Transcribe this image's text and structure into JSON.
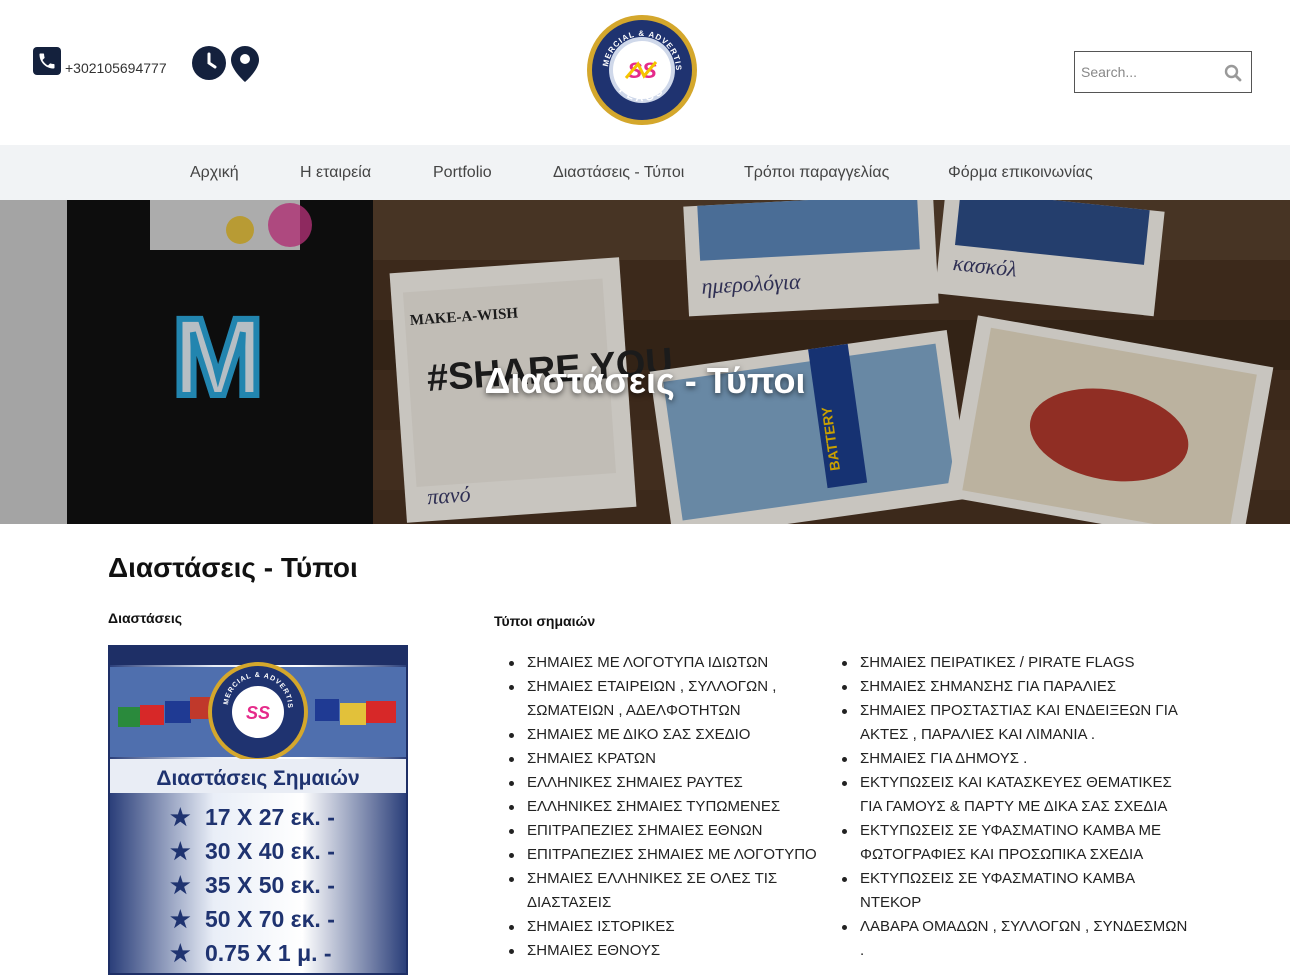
{
  "header": {
    "phone": "+302105694777",
    "logo_text_top": "COMMERCIAL & ADVERTISING",
    "logo_text_bottom": "FLAGS",
    "logo_mark": "SS",
    "search_placeholder": "Search..."
  },
  "nav": {
    "items": [
      {
        "label": "Αρχική"
      },
      {
        "label": "Η εταιρεία"
      },
      {
        "label": "Portfolio"
      },
      {
        "label": "Διαστάσεις - Τύποι"
      },
      {
        "label": "Τρόποι παραγγελίας"
      },
      {
        "label": "Φόρμα επικοινωνίας"
      }
    ]
  },
  "hero": {
    "title": "Διαστάσεις - Τύποι",
    "photo_labels": [
      "ημερολόγια",
      "κασκόλ",
      "πανό",
      "MAKE-A-WISH",
      "#SHARE YOU",
      "BATTERY"
    ]
  },
  "main": {
    "title": "Διαστάσεις - Τύποι",
    "dimensions_heading": "Διαστάσεις",
    "types_heading": "Τύποι σημαιών",
    "poster": {
      "title": "Διαστάσεις Σημαιών",
      "sizes": [
        "17 Χ 27 εκ. -",
        "30 Χ 40 εκ. -",
        "35 Χ 50 εκ. -",
        "50 Χ 70 εκ. -",
        "0.75 Χ 1 μ. -"
      ]
    },
    "types_left": [
      "ΣΗΜΑΙΕΣ  ΜΕ ΛΟΓΟΤΥΠΑ ΙΔΙΩΤΩΝ",
      "ΣΗΜΑΙΕΣ ΕΤΑΙΡΕΙΩΝ , ΣΥΛΛΟΓΩΝ , ΣΩΜΑΤΕΙΩΝ , ΑΔΕΛΦΟΤΗΤΩΝ",
      "ΣΗΜΑΙΕΣ ΜΕ ΔΙΚΟ ΣΑΣ ΣΧΕΔΙΟ",
      "ΣΗΜΑΙΕΣ ΚΡΑΤΩΝ",
      "ΕΛΛΗΝΙΚΕΣ ΣΗΜΑΙΕΣ ΡΑΥΤΕΣ",
      "ΕΛΛΗΝΙΚΕΣ ΣΗΜΑΙΕΣ ΤΥΠΩΜΕΝΕΣ",
      "ΕΠΙΤΡΑΠΕΖΙΕΣ ΣΗΜΑΙΕΣ  ΕΘΝΩΝ",
      "ΕΠΙΤΡΑΠΕΖΙΕΣ ΣΗΜΑΙΕΣ  ΜΕ ΛΟΓΟΤΥΠΟ",
      "ΣΗΜΑΙΕΣ ΕΛΛΗΝΙΚΕΣ  ΣΕ ΟΛΕΣ ΤΙΣ ΔΙΑΣΤΑΣΕΙΣ",
      "ΣΗΜΑΙΕΣ ΙΣΤΟΡΙΚΕΣ",
      "ΣΗΜΑΙΕΣ ΕΘΝΟΥΣ"
    ],
    "types_right": [
      "ΣΗΜΑΙΕΣ ΠΕΙΡΑΤΙΚΕΣ / PIRATE FLAGS",
      "ΣΗΜΑΙΕΣ ΣΗΜΑΝΣΗΣ  ΓΙΑ ΠΑΡΑΛΙΕΣ",
      "ΣΗΜΑΙΕΣ ΠΡΟΣΤΑΣΤΙΑΣ ΚΑΙ ΕΝΔΕΙΞΕΩΝ ΓΙΑ ΑΚΤΕΣ , ΠΑΡΑΛΙΕΣ ΚΑΙ ΛΙΜΑΝΙΑ .",
      "ΣΗΜΑΙΕΣ ΓΙΑ ΔΗΜΟΥΣ .",
      "ΕΚΤΥΠΩΣΕΙΣ ΚΑΙ ΚΑΤΑΣΚΕΥΕΣ ΘΕΜΑΤΙΚΕΣ ΓΙΑ ΓΑΜΟΥΣ & ΠΑΡΤΥ ΜΕ ΔΙΚΑ ΣΑΣ ΣΧΕΔΙΑ",
      "ΕΚΤΥΠΩΣΕΙΣ ΣΕ ΥΦΑΣΜΑΤΙΝΟ ΚΑΜΒΑ ΜΕ ΦΩΤΟΓΡΑΦΙΕΣ ΚΑΙ ΠΡΟΣΩΠΙΚΑ ΣΧΕΔΙΑ",
      "ΕΚΤΥΠΩΣΕΙΣ ΣΕ ΥΦΑΣΜΑΤΙΝΟ ΚΑΜΒΑ ΝΤΕΚΟΡ",
      "ΛΑΒΑΡΑ ΟΜΑΔΩΝ  ,  ΣΥΛΛΟΓΩΝ  ,  ΣΥΝΔΕΣΜΩΝ ."
    ]
  },
  "colors": {
    "navy": "#14213d",
    "nav_bg": "#f1f3f5",
    "logo_gold": "#d4a72c",
    "logo_blue": "#1f3370"
  }
}
